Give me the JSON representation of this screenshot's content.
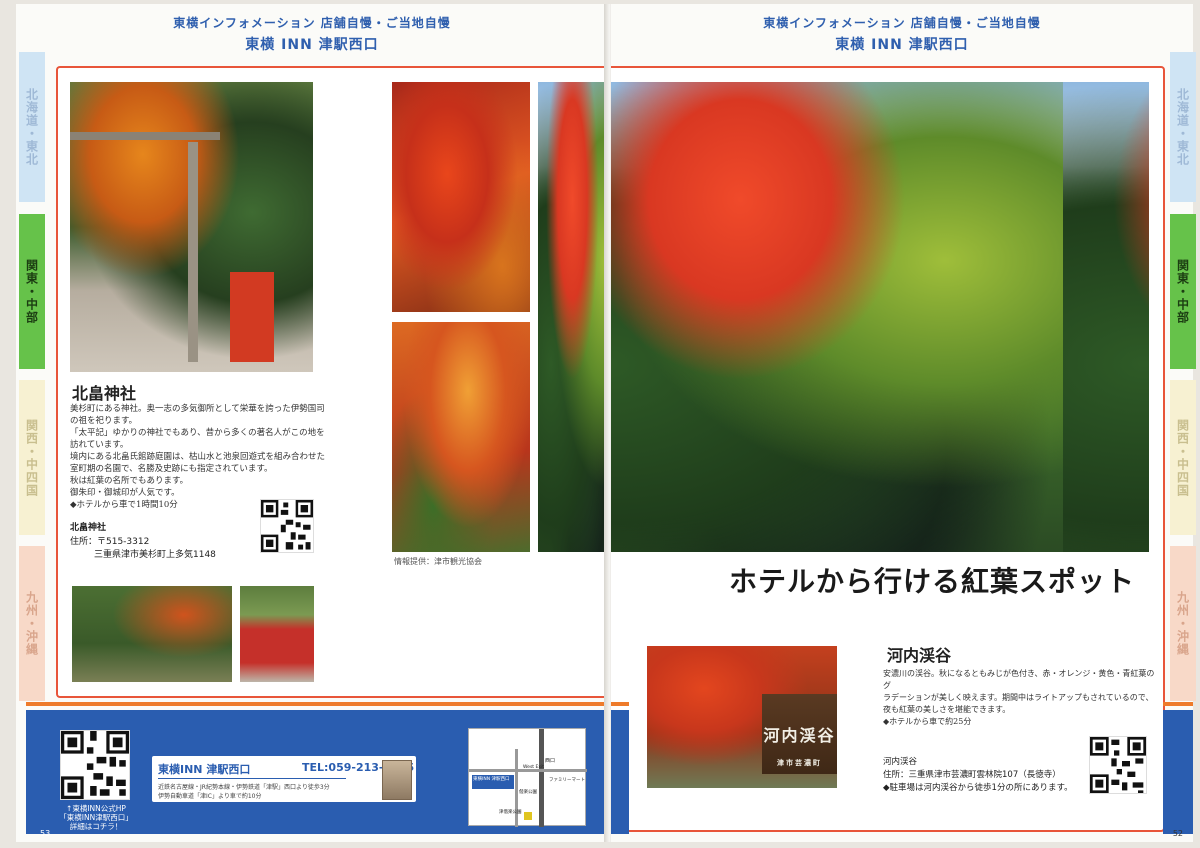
{
  "header": {
    "category": "東横インフォメーション 店舗自慢・ご当地自慢",
    "hotel": "東横 INN 津駅西口"
  },
  "tabs": [
    {
      "label": "北海道・東北",
      "color": "#cfe4f4",
      "text": "#9fb9d6"
    },
    {
      "label": "関東・中部",
      "color": "#66c24a",
      "text": "#1c3e12"
    },
    {
      "label": "関西・中四国",
      "color": "#f7f1d2",
      "text": "#c9bf8f"
    },
    {
      "label": "九州・沖縄",
      "color": "#f8d9c8",
      "text": "#d9a58c"
    }
  ],
  "shrine": {
    "name": "北畠神社",
    "desc": [
      "美杉町にある神社。奥一志の多気御所として栄華を誇った伊勢国司",
      "の祖を祀ります。",
      "「太平記」ゆかりの神社でもあり、昔から多くの著名人がこの地を",
      "訪れています。",
      "境内にある北畠氏館跡庭園は、枯山水と池泉回遊式を組み合わせた",
      "室町期の名園で、名勝及史跡にも指定されています。",
      "秋は紅葉の名所でもあります。",
      "御朱印・御城印が人気です。",
      "◆ホテルから車で1時間10分"
    ],
    "info_name": "北畠神社",
    "info_addr1": "住所：〒515-3312",
    "info_addr2": "三重県津市美杉町上多気1148"
  },
  "credit": "情報提供：津市観光協会",
  "feature_title": "ホテルから行ける紅葉スポット",
  "kawachi": {
    "name": "河内渓谷",
    "desc": [
      "安濃川の渓谷。秋になるともみじが色付き、赤・オレンジ・黄色・青紅葉のグ",
      "ラデーションが美しく映えます。期間中はライトアップもされているので、",
      "夜も紅葉の美しさを堪能できます。",
      "◆ホテルから車で約25分"
    ],
    "info_name": "河内渓谷",
    "info_addr": "住所：三重県津市芸濃町雲林院107（長徳寺）",
    "info_parking": "◆駐車場は河内渓谷から徒歩1分の所にあります。",
    "sign": "河内渓谷",
    "sign_sub": "津市芸濃町"
  },
  "footer": {
    "qr_caption1": "↑東横INN公式HP",
    "qr_caption2": "「東横INN津駅西口」",
    "qr_caption3": "詳細はコチラ！",
    "hotel_name": "東横INN 津駅西口",
    "tel": "TEL:059-213-1045",
    "access1": "近鉄名古屋線・JR紀勢本線・伊勢鉄道「津駅」西口より徒歩3分",
    "access2": "伊勢自動車道「津IC」より車で約10分",
    "map_west": "西口",
    "map_west_en": "West Exit",
    "map_hotel": "東横INN 津駅西口",
    "map_family": "ファミリーマート",
    "map_shrine": "偕楽公園",
    "map_park": "津偕楽公園"
  },
  "pages": {
    "left": "53",
    "right": "52"
  }
}
